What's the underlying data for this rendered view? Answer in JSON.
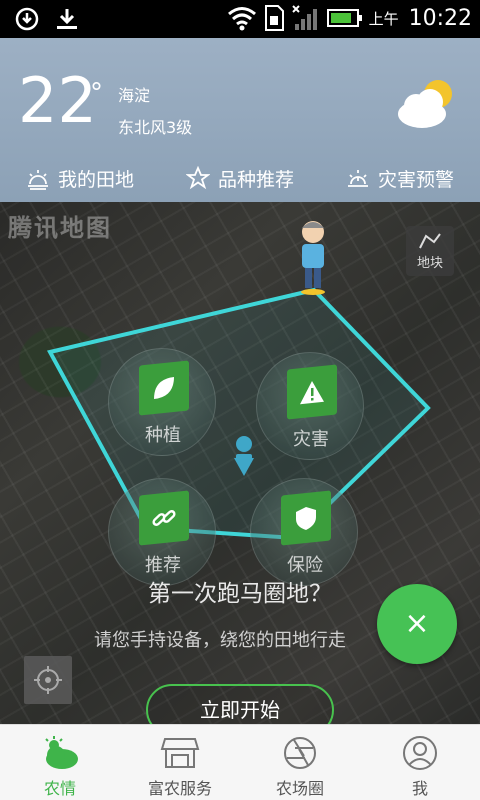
{
  "status_bar": {
    "ampm": "上午",
    "time": "10:22"
  },
  "weather": {
    "temperature": "22",
    "degree_symbol": "°",
    "location": "海淀",
    "wind": "东北风3级",
    "icon": "cloud-sun-icon"
  },
  "weather_nav": {
    "items": [
      {
        "label": "我的田地",
        "icon": "sun-field-icon"
      },
      {
        "label": "品种推荐",
        "icon": "star-icon"
      },
      {
        "label": "灾害预警",
        "icon": "sun-warning-icon"
      }
    ]
  },
  "map": {
    "logo": "腾讯地图",
    "plot_button": "地块",
    "bubbles": [
      {
        "label": "种植",
        "icon": "leaf-icon"
      },
      {
        "label": "灾害",
        "icon": "warning-icon"
      },
      {
        "label": "推荐",
        "icon": "link-icon"
      },
      {
        "label": "保险",
        "icon": "shield-icon"
      }
    ],
    "headline": "第一次跑马圈地？",
    "subline": "请您手持设备，绕您的田地行走",
    "start_button": "立即开始",
    "fab_label": "×"
  },
  "tabbar": {
    "tabs": [
      {
        "label": "农情",
        "active": true
      },
      {
        "label": "富农服务",
        "active": false
      },
      {
        "label": "农场圈",
        "active": false
      },
      {
        "label": "我",
        "active": false
      }
    ]
  },
  "colors": {
    "accent_green": "#46c255",
    "polygon_cyan": "#3fd6d8"
  }
}
